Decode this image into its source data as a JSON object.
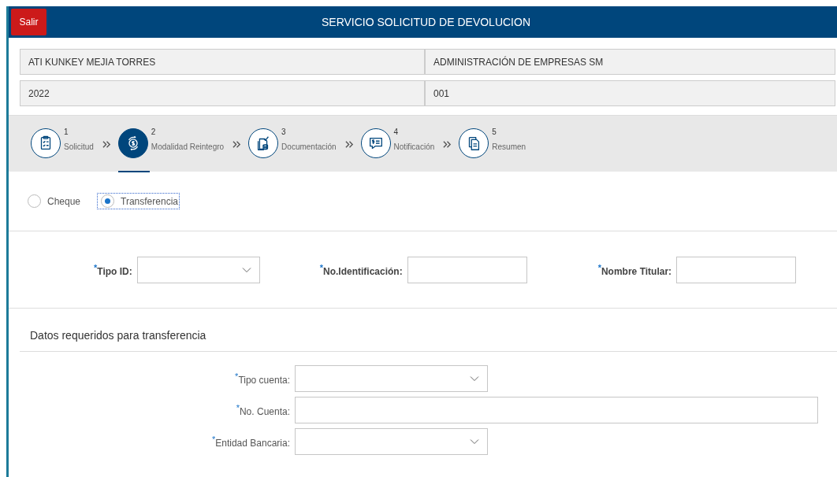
{
  "header": {
    "exit_button": "Salir",
    "title": "SERVICIO SOLICITUD DE DEVOLUCION"
  },
  "info_rows": [
    {
      "cells": [
        "ATI KUNKEY MEJIA TORRES",
        "ADMINISTRACIÓN DE EMPRESAS SM"
      ]
    },
    {
      "cells": [
        "2022",
        "001"
      ]
    }
  ],
  "steps": [
    {
      "number": "1",
      "label": "Solicitud",
      "selected": false
    },
    {
      "number": "2",
      "label": "Modalidad Reintegro",
      "selected": true
    },
    {
      "number": "3",
      "label": "Documentación",
      "selected": false
    },
    {
      "number": "4",
      "label": "Notificación",
      "selected": false
    },
    {
      "number": "5",
      "label": "Resumen",
      "selected": false
    }
  ],
  "payment_options": [
    {
      "label": "Cheque",
      "selected": false
    },
    {
      "label": "Transferencia",
      "selected": true
    }
  ],
  "holder_fields": [
    {
      "label": "$^{*}$Tipo ID:",
      "kind": "select"
    },
    {
      "label": "$^{*}$No.Identificación:",
      "kind": "text"
    },
    {
      "label": "$^{*}$Nombre Titular:",
      "kind": "text"
    }
  ],
  "transfer_section": {
    "title": "Datos requeridos para transferencia",
    "fields": [
      {
        "label": "$^{*}$Tipo cuenta:",
        "kind": "select"
      },
      {
        "label": "$^{*}$No. Cuenta:",
        "kind": "text"
      },
      {
        "label": "$^{*}$Entidad Bancaria:",
        "kind": "select"
      }
    ]
  }
}
